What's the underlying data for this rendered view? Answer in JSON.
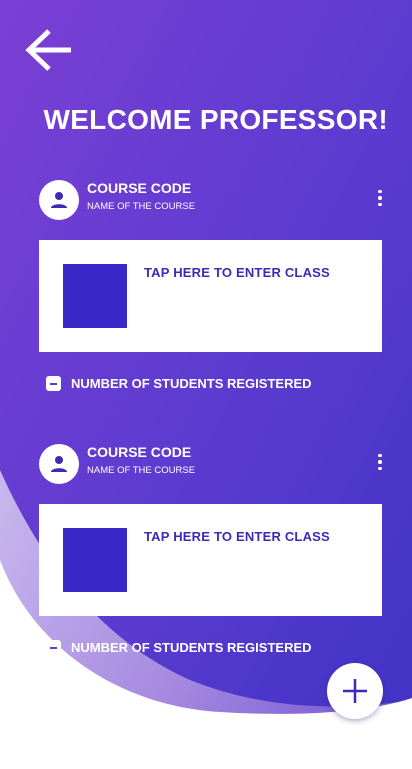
{
  "header": {
    "back_icon": "arrow-left-icon",
    "title": "WELCOME PROFESSOR!"
  },
  "courses": [
    {
      "code": "COURSE CODE",
      "name": "NAME OF THE COURSE",
      "avatar_icon": "person-icon",
      "menu_icon": "more-vertical-icon",
      "enter_label": "TAP HERE TO ENTER CLASS",
      "students_label": "NUMBER OF STUDENTS REGISTERED",
      "students_icon": "minus-square-icon"
    },
    {
      "code": "COURSE CODE",
      "name": "NAME OF THE COURSE",
      "avatar_icon": "person-icon",
      "menu_icon": "more-vertical-icon",
      "enter_label": "TAP HERE TO ENTER CLASS",
      "students_label": "NUMBER OF STUDENTS REGISTERED",
      "students_icon": "minus-square-icon"
    }
  ],
  "fab": {
    "icon": "plus-icon"
  },
  "colors": {
    "gradient_start": "#7b3fd4",
    "gradient_end": "#3f33c4",
    "accent": "#3b28c8",
    "wave_light": "#b9a6e8"
  }
}
